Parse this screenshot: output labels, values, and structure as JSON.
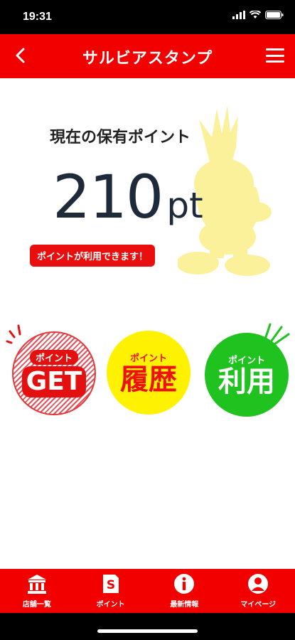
{
  "status_bar": {
    "time": "19:31"
  },
  "header": {
    "title": "サルビアスタンプ"
  },
  "points": {
    "label": "現在の保有ポイント",
    "value": "210",
    "unit": "pt",
    "badge": "ポイントが利用できます！"
  },
  "actions": [
    {
      "small": "ポイント",
      "big": "GET"
    },
    {
      "small": "ポイント",
      "big": "履歴"
    },
    {
      "small": "ポイント",
      "big": "利用"
    }
  ],
  "bottom_nav": [
    {
      "label": "店舗一覧",
      "icon": "bank-icon"
    },
    {
      "label": "ポイント",
      "icon": "point-card-icon"
    },
    {
      "label": "最新情報",
      "icon": "info-icon"
    },
    {
      "label": "マイページ",
      "icon": "user-icon"
    }
  ],
  "colors": {
    "brand_red": "#f20000",
    "history_yellow": "#fff200",
    "use_green": "#1fc21f",
    "mascot_yellow": "#fbf19a"
  }
}
